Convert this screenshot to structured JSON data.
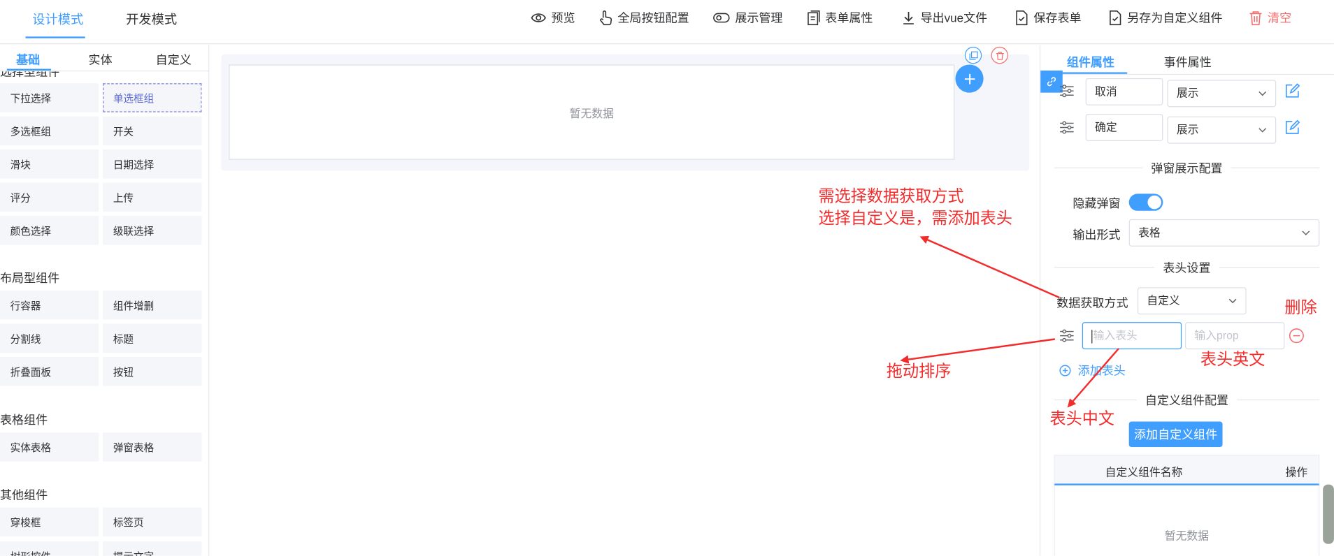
{
  "header": {
    "modes": [
      "设计模式",
      "开发模式"
    ],
    "tools": {
      "preview": "预览",
      "global_buttons": "全局按钮配置",
      "display_manage": "展示管理",
      "form_props": "表单属性",
      "export_vue": "导出vue文件",
      "save_form": "保存表单",
      "save_as_component": "另存为自定义组件",
      "clear": "清空"
    }
  },
  "left_panel": {
    "tabs": [
      "基础",
      "实体",
      "自定义"
    ],
    "partial_title": "选择型组件",
    "groups": {
      "select": [
        "下拉选择",
        "单选框组",
        "多选框组",
        "开关",
        "滑块",
        "日期选择",
        "评分",
        "上传",
        "颜色选择",
        "级联选择"
      ],
      "layout_title": "布局型组件",
      "layout": [
        "行容器",
        "组件增删",
        "分割线",
        "标题",
        "折叠面板",
        "按钮"
      ],
      "table_title": "表格组件",
      "table": [
        "实体表格",
        "弹窗表格"
      ],
      "other_title": "其他组件",
      "other": [
        "穿梭框",
        "标签页",
        "树形控件",
        "提示文字"
      ]
    }
  },
  "canvas": {
    "empty_text": "暂无数据"
  },
  "right_panel": {
    "tabs": [
      "组件属性",
      "事件属性"
    ],
    "button_rows": [
      {
        "name": "取消",
        "display": "展示"
      },
      {
        "name": "确定",
        "display": "展示"
      }
    ],
    "popup_section": "弹窗展示配置",
    "hide_popup_label": "隐藏弹窗",
    "hide_popup_on": true,
    "output_label": "输出形式",
    "output_value": "表格",
    "header_section": "表头设置",
    "data_fetch_label": "数据获取方式",
    "data_fetch_value": "自定义",
    "header_input_placeholder": "输入表头",
    "prop_input_placeholder": "输入prop",
    "add_header": "添加表头",
    "custom_section": "自定义组件配置",
    "add_custom_btn": "添加自定义组件",
    "table_cols": [
      "自定义组件名称",
      "操作"
    ],
    "table_empty": "暂无数据"
  },
  "annotations": {
    "note_line1": "需选择数据获取方式",
    "note_line2": "选择自定义是，需添加表头",
    "delete": "删除",
    "drag_sort": "拖动排序",
    "header_en": "表头英文",
    "header_cn": "表头中文"
  },
  "colors": {
    "accent": "#409eff",
    "danger": "#f56c6c",
    "annotation": "#f22c2c"
  }
}
